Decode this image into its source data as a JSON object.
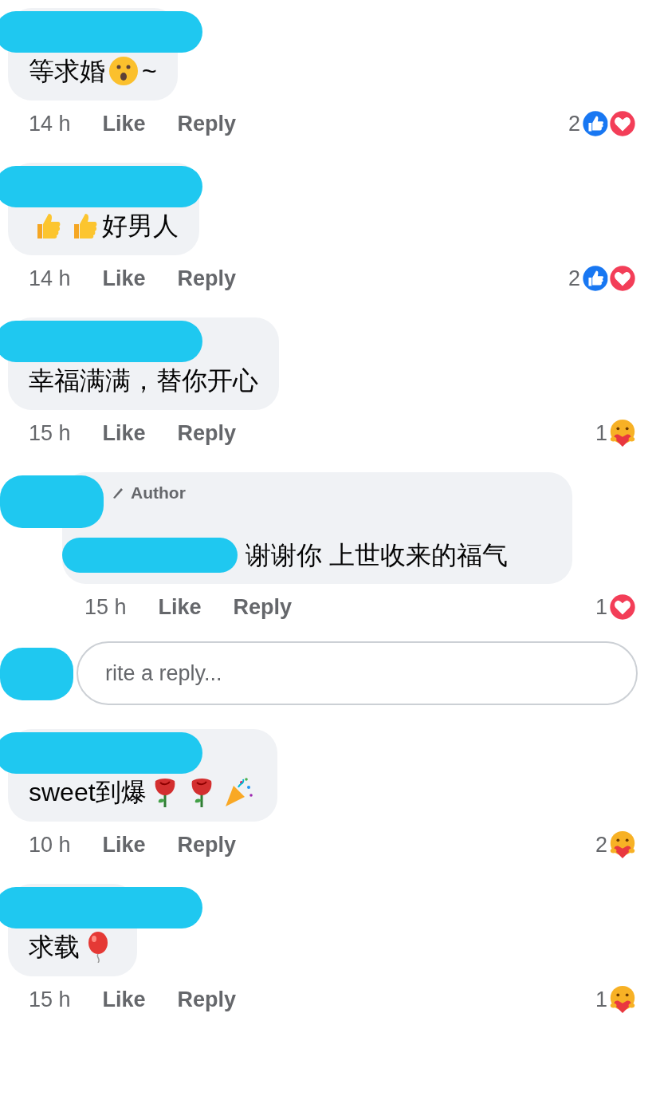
{
  "comments": [
    {
      "kind": "comment",
      "body": [
        {
          "kind": "text",
          "text": "等求婚"
        },
        {
          "kind": "surprised-face"
        },
        {
          "kind": "text",
          "text": "~"
        }
      ],
      "time": "14 h",
      "like": "Like",
      "reply": "Reply",
      "reaction_count": "2",
      "reactions": [
        {
          "kind": "like"
        },
        {
          "kind": "love"
        }
      ]
    },
    {
      "kind": "comment",
      "body": [
        {
          "kind": "thumbs-up"
        },
        {
          "kind": "thumbs-up"
        },
        {
          "kind": "text",
          "text": "好男人"
        }
      ],
      "time": "14 h",
      "like": "Like",
      "reply": "Reply",
      "reaction_count": "2",
      "reactions": [
        {
          "kind": "like"
        },
        {
          "kind": "love"
        }
      ]
    },
    {
      "kind": "comment",
      "body": [
        {
          "kind": "text",
          "text": "幸福满满，替你开心"
        }
      ],
      "time": "15 h",
      "like": "Like",
      "reply": "Reply",
      "reaction_count": "1",
      "reactions": [
        {
          "kind": "care"
        }
      ]
    },
    {
      "kind": "reply",
      "badge": "Author",
      "body": [
        {
          "kind": "mention"
        },
        {
          "kind": "text",
          "text": "谢谢你 上世收来的福气"
        }
      ],
      "time": "15 h",
      "like": "Like",
      "reply": "Reply",
      "reaction_count": "1",
      "reactions": [
        {
          "kind": "love"
        }
      ]
    },
    {
      "kind": "reply-field",
      "placeholder": "rite a reply..."
    },
    {
      "kind": "comment",
      "body": [
        {
          "kind": "text",
          "text": "sweet到爆"
        },
        {
          "kind": "rose"
        },
        {
          "kind": "rose"
        },
        {
          "kind": "party-popper"
        }
      ],
      "time": "10 h",
      "like": "Like",
      "reply": "Reply",
      "reaction_count": "2",
      "reactions": [
        {
          "kind": "care"
        }
      ]
    },
    {
      "kind": "comment",
      "body": [
        {
          "kind": "text",
          "text": "求载"
        },
        {
          "kind": "balloon"
        }
      ],
      "time": "15 h",
      "like": "Like",
      "reply": "Reply",
      "reaction_count": "1",
      "reactions": [
        {
          "kind": "care"
        }
      ]
    }
  ]
}
